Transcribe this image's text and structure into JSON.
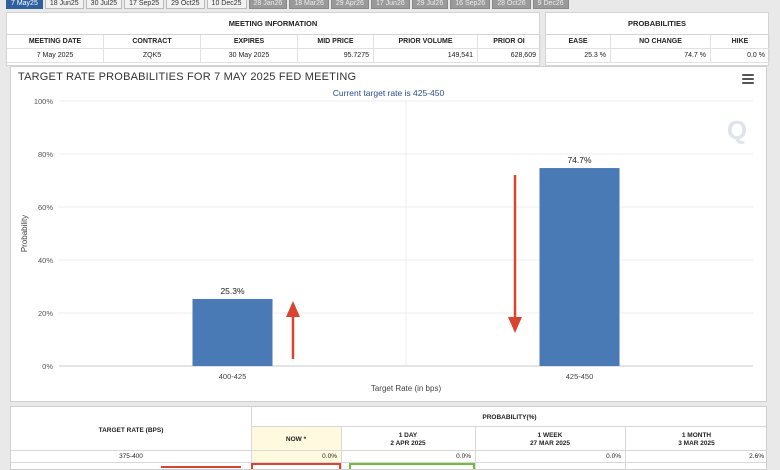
{
  "tabs": [
    {
      "label": "7 May25",
      "state": "active"
    },
    {
      "label": "18 Jun25",
      "state": "normal"
    },
    {
      "label": "30 Jul25",
      "state": "normal"
    },
    {
      "label": "17 Sep25",
      "state": "normal"
    },
    {
      "label": "29 Oct25",
      "state": "normal"
    },
    {
      "label": "10 Dec25",
      "state": "normal"
    },
    {
      "label": "28 Jan26",
      "state": "gray"
    },
    {
      "label": "18 Mar26",
      "state": "gray"
    },
    {
      "label": "29 Apr26",
      "state": "gray"
    },
    {
      "label": "17 Jun26",
      "state": "gray"
    },
    {
      "label": "29 Jul26",
      "state": "gray"
    },
    {
      "label": "16 Sep26",
      "state": "gray"
    },
    {
      "label": "28 Oct26",
      "state": "gray"
    },
    {
      "label": "9 Dec26",
      "state": "gray"
    }
  ],
  "meeting_info": {
    "title": "MEETING INFORMATION",
    "headers": [
      "MEETING DATE",
      "CONTRACT",
      "EXPIRES",
      "MID PRICE",
      "PRIOR VOLUME",
      "PRIOR OI"
    ],
    "values": [
      "7 May 2025",
      "ZQK5",
      "30 May 2025",
      "95.7275",
      "149,541",
      "628,609"
    ]
  },
  "probabilities": {
    "title": "PROBABILITIES",
    "headers": [
      "EASE",
      "NO CHANGE",
      "HIKE"
    ],
    "values": [
      "25.3 %",
      "74.7 %",
      "0.0 %"
    ]
  },
  "chart": {
    "title": "TARGET RATE PROBABILITIES FOR 7 MAY 2025 FED MEETING",
    "subtitle": "Current target rate is 425-450",
    "watermark": "Q",
    "menu_icon": "hamburger-menu-icon",
    "arrow_color": "#d9432f"
  },
  "chart_data": {
    "type": "bar",
    "title": "TARGET RATE PROBABILITIES FOR 7 MAY 2025 FED MEETING",
    "subtitle": "Current target rate is 425-450",
    "categories": [
      "400-425",
      "425-450"
    ],
    "values": [
      25.3,
      74.7
    ],
    "data_labels": [
      "25.3%",
      "74.7%"
    ],
    "xlabel": "Target Rate (in bps)",
    "ylabel": "Probability",
    "ylim": [
      0,
      100
    ],
    "yticks": [
      "0%",
      "20%",
      "40%",
      "60%",
      "80%",
      "100%"
    ],
    "bar_color": "#4a7ab5",
    "grid": true
  },
  "bottom_table": {
    "left_header": "TARGET RATE (BPS)",
    "top_header": "PROBABILITY(%)",
    "columns": [
      {
        "title": "NOW",
        "sub": "",
        "marker": "*"
      },
      {
        "title": "1 DAY",
        "sub": "2 APR 2025",
        "marker": ""
      },
      {
        "title": "1 WEEK",
        "sub": "27 MAR 2025",
        "marker": ""
      },
      {
        "title": "1 MONTH",
        "sub": "3 MAR 2025",
        "marker": ""
      }
    ],
    "rows": [
      {
        "rate": "375-400",
        "values": [
          "0.0%",
          "0.0%",
          "0.0%",
          "2.6%"
        ]
      }
    ]
  }
}
